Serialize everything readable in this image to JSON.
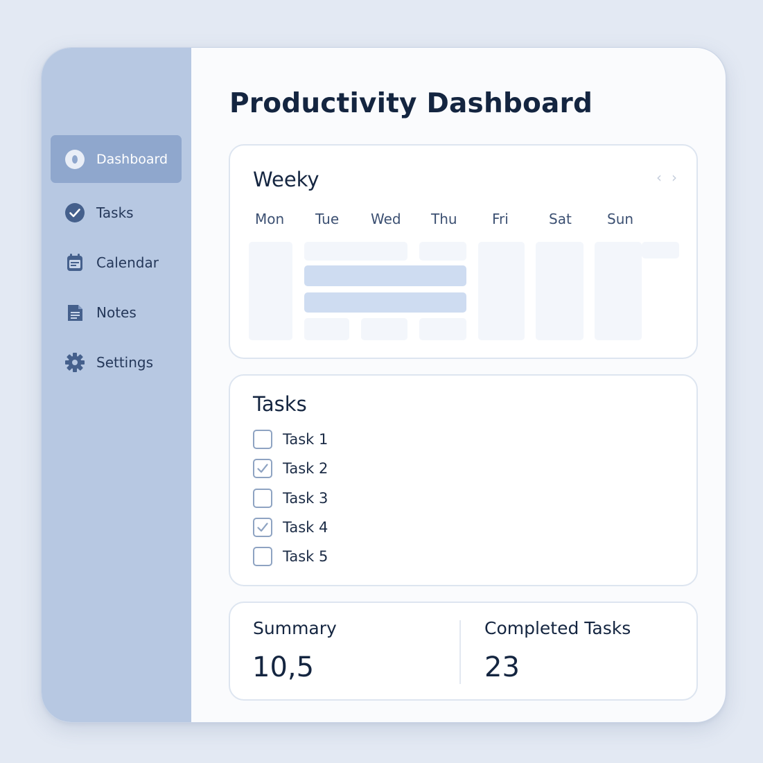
{
  "app": {
    "title": "Productivity Dashboard"
  },
  "colors": {
    "sidebar": "#b7c8e2",
    "sidebar_active": "#8fa7cd",
    "accent_bar": "#cedcf1",
    "text_dark": "#142540"
  },
  "sidebar": {
    "items": [
      {
        "label": "Dashboard",
        "icon": "dashboard-icon",
        "active": true
      },
      {
        "label": "Tasks",
        "icon": "check-circle-icon",
        "active": false
      },
      {
        "label": "Calendar",
        "icon": "calendar-icon",
        "active": false
      },
      {
        "label": "Notes",
        "icon": "notes-icon",
        "active": false
      },
      {
        "label": "Settings",
        "icon": "gear-icon",
        "active": false
      }
    ]
  },
  "weekly": {
    "title": "Weeky",
    "prev_icon": "chevron-left-icon",
    "next_icon": "chevron-right-icon",
    "prev_glyph": "‹",
    "next_glyph": "›",
    "days": [
      "Mon",
      "Tue",
      "Wed",
      "Thu",
      "Fri",
      "Sat",
      "Sun"
    ]
  },
  "tasks": {
    "title": "Tasks",
    "items": [
      {
        "label": "Task 1",
        "checked": false
      },
      {
        "label": "Task 2",
        "checked": true
      },
      {
        "label": "Task 3",
        "checked": false
      },
      {
        "label": "Task 4",
        "checked": true
      },
      {
        "label": "Task 5",
        "checked": false
      }
    ]
  },
  "summary": {
    "left": {
      "label": "Summary",
      "value": "10,5"
    },
    "right": {
      "label": "Completed Tasks",
      "value": "23"
    }
  }
}
